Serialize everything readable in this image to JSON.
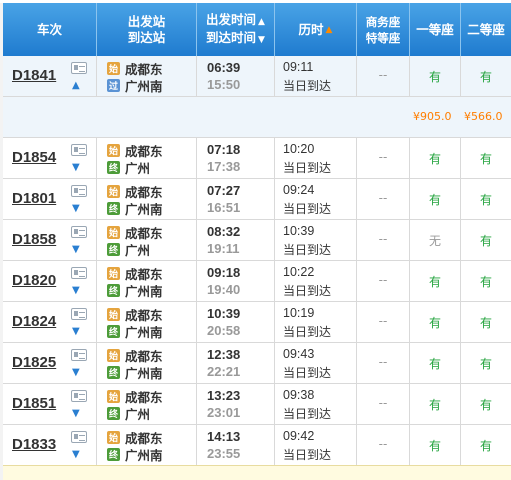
{
  "header": {
    "train_no": "车次",
    "station_top": "出发站",
    "station_bottom": "到达站",
    "time_top": "出发时间",
    "time_bottom": "到达时间",
    "duration": "历时",
    "business_top": "商务座",
    "business_bottom": "特等座",
    "first_class": "一等座",
    "second_class": "二等座",
    "sort_up": "▲",
    "sort_down": "▼"
  },
  "station_badges": {
    "start": "始",
    "end": "终",
    "pass": "过"
  },
  "expanded_prices": {
    "first": "¥905.0",
    "second": "¥566.0"
  },
  "rows": [
    {
      "train": "D1841",
      "from": "成都东",
      "to": "广州南",
      "dep": "06:39",
      "arr": "15:50",
      "dur": "09:11",
      "note": "当日到达",
      "biz": "--",
      "first": "有",
      "second": "有",
      "arrow": "▲",
      "to_badge": "pass"
    },
    {
      "train": "D1854",
      "from": "成都东",
      "to": "广州",
      "dep": "07:18",
      "arr": "17:38",
      "dur": "10:20",
      "note": "当日到达",
      "biz": "--",
      "first": "有",
      "second": "有",
      "arrow": "▼",
      "to_badge": "end"
    },
    {
      "train": "D1801",
      "from": "成都东",
      "to": "广州南",
      "dep": "07:27",
      "arr": "16:51",
      "dur": "09:24",
      "note": "当日到达",
      "biz": "--",
      "first": "有",
      "second": "有",
      "arrow": "▼",
      "to_badge": "end"
    },
    {
      "train": "D1858",
      "from": "成都东",
      "to": "广州",
      "dep": "08:32",
      "arr": "19:11",
      "dur": "10:39",
      "note": "当日到达",
      "biz": "--",
      "first": "无",
      "second": "有",
      "arrow": "▼",
      "to_badge": "end"
    },
    {
      "train": "D1820",
      "from": "成都东",
      "to": "广州南",
      "dep": "09:18",
      "arr": "19:40",
      "dur": "10:22",
      "note": "当日到达",
      "biz": "--",
      "first": "有",
      "second": "有",
      "arrow": "▼",
      "to_badge": "end"
    },
    {
      "train": "D1824",
      "from": "成都东",
      "to": "广州南",
      "dep": "10:39",
      "arr": "20:58",
      "dur": "10:19",
      "note": "当日到达",
      "biz": "--",
      "first": "有",
      "second": "有",
      "arrow": "▼",
      "to_badge": "end"
    },
    {
      "train": "D1825",
      "from": "成都东",
      "to": "广州南",
      "dep": "12:38",
      "arr": "22:21",
      "dur": "09:43",
      "note": "当日到达",
      "biz": "--",
      "first": "有",
      "second": "有",
      "arrow": "▼",
      "to_badge": "end"
    },
    {
      "train": "D1851",
      "from": "成都东",
      "to": "广州",
      "dep": "13:23",
      "arr": "23:01",
      "dur": "09:38",
      "note": "当日到达",
      "biz": "--",
      "first": "有",
      "second": "有",
      "arrow": "▼",
      "to_badge": "end"
    },
    {
      "train": "D1833",
      "from": "成都东",
      "to": "广州南",
      "dep": "14:13",
      "arr": "23:55",
      "dur": "09:42",
      "note": "当日到达",
      "biz": "--",
      "first": "有",
      "second": "有",
      "arrow": "▼",
      "to_badge": "end"
    }
  ],
  "colors": {
    "header_top": "#49a3e6",
    "header_bottom": "#1f7bcf",
    "available": "#23a33d",
    "price": "#ff7e00",
    "sort_active": "#ff8a00"
  }
}
